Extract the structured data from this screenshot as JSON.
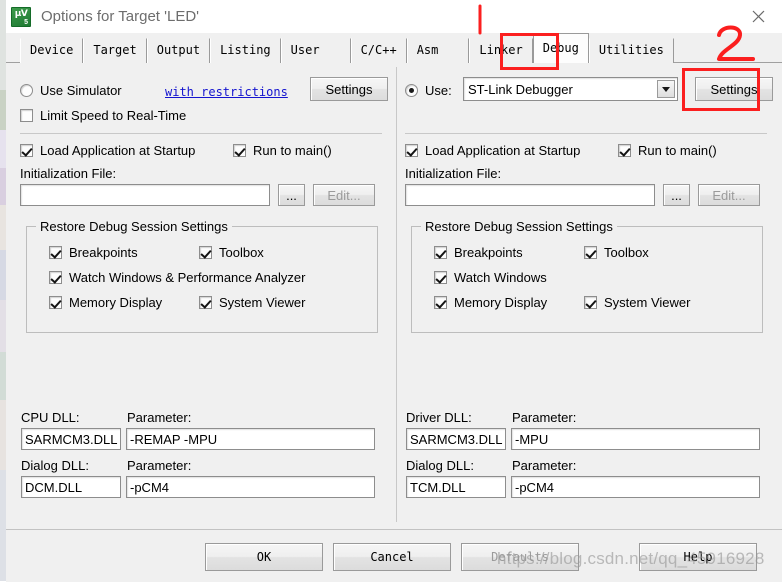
{
  "window": {
    "title": "Options for Target 'LED'",
    "icon": "keil-uvision-icon",
    "close_label": "✕"
  },
  "tabs": [
    {
      "label": "Device",
      "active": false
    },
    {
      "label": "Target",
      "active": false
    },
    {
      "label": "Output",
      "active": false
    },
    {
      "label": "Listing",
      "active": false
    },
    {
      "label": "User",
      "active": false
    },
    {
      "label": "C/C++",
      "active": false
    },
    {
      "label": "Asm",
      "active": false
    },
    {
      "label": "Linker",
      "active": false
    },
    {
      "label": "Debug",
      "active": true
    },
    {
      "label": "Utilities",
      "active": false
    }
  ],
  "left_panel": {
    "use_simulator": {
      "label": "Use Simulator",
      "checked": false
    },
    "with_restrictions_link": "with restrictions",
    "settings_button": "Settings",
    "limit_speed": {
      "label": "Limit Speed to Real-Time",
      "checked": false
    },
    "load_application": {
      "label": "Load Application at Startup",
      "checked": true
    },
    "run_to_main": {
      "label": "Run to main()",
      "checked": true
    },
    "init_file_label": "Initialization File:",
    "init_file_value": "",
    "browse_button": "...",
    "edit_button": "Edit...",
    "restore_group": {
      "title": "Restore Debug Session Settings",
      "items": [
        {
          "label": "Breakpoints",
          "checked": true
        },
        {
          "label": "Toolbox",
          "checked": true
        },
        {
          "label": "Watch Windows & Performance Analyzer",
          "checked": true
        },
        {
          "label": "Memory Display",
          "checked": true
        },
        {
          "label": "System Viewer",
          "checked": true
        }
      ]
    },
    "cpu_dll_label": "CPU DLL:",
    "cpu_dll_value": "SARMCM3.DLL",
    "cpu_param_label": "Parameter:",
    "cpu_param_value": "-REMAP -MPU",
    "dialog_dll_label": "Dialog DLL:",
    "dialog_dll_value": "DCM.DLL",
    "dialog_param_label": "Parameter:",
    "dialog_param_value": "-pCM4"
  },
  "right_panel": {
    "use_radio": {
      "label": "Use:",
      "checked": true
    },
    "debugger_selected": "ST-Link Debugger",
    "settings_button": "Settings",
    "load_application": {
      "label": "Load Application at Startup",
      "checked": true
    },
    "run_to_main": {
      "label": "Run to main()",
      "checked": true
    },
    "init_file_label": "Initialization File:",
    "init_file_value": "",
    "browse_button": "...",
    "edit_button": "Edit...",
    "restore_group": {
      "title": "Restore Debug Session Settings",
      "items": [
        {
          "label": "Breakpoints",
          "checked": true
        },
        {
          "label": "Toolbox",
          "checked": true
        },
        {
          "label": "Watch Windows",
          "checked": true
        },
        {
          "label": "Memory Display",
          "checked": true
        },
        {
          "label": "System Viewer",
          "checked": true
        }
      ]
    },
    "driver_dll_label": "Driver DLL:",
    "driver_dll_value": "SARMCM3.DLL",
    "driver_param_label": "Parameter:",
    "driver_param_value": "-MPU",
    "dialog_dll_label": "Dialog DLL:",
    "dialog_dll_value": "TCM.DLL",
    "dialog_param_label": "Parameter:",
    "dialog_param_value": "-pCM4"
  },
  "footer": {
    "ok": "OK",
    "cancel": "Cancel",
    "defaults": "Defaults",
    "help": "Help"
  },
  "annotations": {
    "marker_one": "1",
    "marker_two": "2",
    "color": "#fb1f1f"
  },
  "watermark": "https://blog.csdn.net/qq_45916928"
}
